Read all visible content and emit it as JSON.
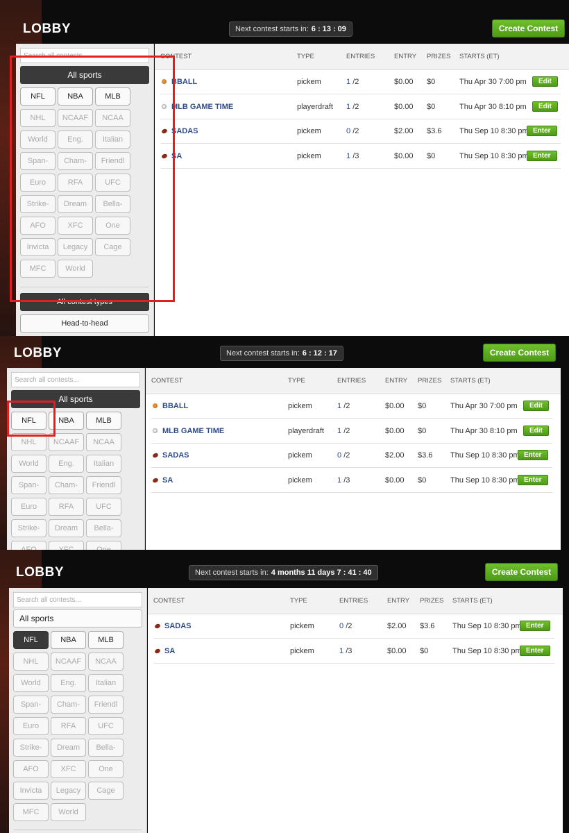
{
  "header": {
    "title": "LOBBY",
    "countdown_label": "Next contest starts in:",
    "create_label": "Create Contest"
  },
  "panels": [
    {
      "countdown_value": "6 : 13 : 09",
      "search_placeholder": "Search all contests...",
      "all_sports_label": "All sports"
    },
    {
      "countdown_value": "6 : 12 : 17",
      "search_placeholder": "Search all contests...",
      "all_sports_label": "All sports"
    },
    {
      "countdown_value": "4 months 11 days 7 : 41 : 40",
      "search_placeholder": "Search all contests...",
      "all_sports_label": "All sports"
    }
  ],
  "sports": [
    "NFL",
    "NBA",
    "MLB",
    "NHL",
    "NCAAF",
    "NCAA",
    "World",
    "Eng.",
    "Italian",
    "Span-",
    "Cham-",
    "Friendl",
    "Euro",
    "RFA",
    "UFC",
    "Strike-",
    "Dream",
    "Bella-",
    "AFO",
    "XFC",
    "One",
    "Invicta",
    "Legacy",
    "Cage",
    "MFC",
    "World"
  ],
  "contest_types": {
    "all": "All contest types",
    "h2h": "Head-to-head"
  },
  "table_headers": {
    "contest": "CONTEST",
    "type": "TYPE",
    "entries": "ENTRIES",
    "entry": "ENTRY",
    "prizes": "PRIZES",
    "starts": "STARTS (ET)"
  },
  "contests_all": [
    {
      "icon": "basketball-icon",
      "name": "BBALL",
      "type": "pickem",
      "entries": "1",
      "max": "/2",
      "entry": "$0.00",
      "prizes": "$0",
      "starts": "Thu Apr 30 7:00 pm",
      "action": "Edit"
    },
    {
      "icon": "baseball-icon",
      "name": "MLB GAME TIME",
      "type": "playerdraft",
      "entries": "1",
      "max": "/2",
      "entry": "$0.00",
      "prizes": "$0",
      "starts": "Thu Apr 30 8:10 pm",
      "action": "Edit"
    },
    {
      "icon": "football-icon",
      "name": "SADAS",
      "type": "pickem",
      "entries": "0",
      "max": "/2",
      "entry": "$2.00",
      "prizes": "$3.6",
      "starts": "Thu Sep 10 8:30 pm",
      "action": "Enter"
    },
    {
      "icon": "football-icon",
      "name": "SA",
      "type": "pickem",
      "entries": "1",
      "max": "/3",
      "entry": "$0.00",
      "prizes": "$0",
      "starts": "Thu Sep 10 8:30 pm",
      "action": "Enter"
    }
  ],
  "contests_nfl": [
    {
      "icon": "football-icon",
      "name": "SADAS",
      "type": "pickem",
      "entries": "0",
      "max": "/2",
      "entry": "$2.00",
      "prizes": "$3.6",
      "starts": "Thu Sep 10 8:30 pm",
      "action": "Enter"
    },
    {
      "icon": "football-icon",
      "name": "SA",
      "type": "pickem",
      "entries": "1",
      "max": "/3",
      "entry": "$0.00",
      "prizes": "$0",
      "starts": "Thu Sep 10 8:30 pm",
      "action": "Enter"
    }
  ],
  "colors": {
    "accent_green": "#5aad1f",
    "link_blue": "#2e4b8a",
    "highlight_red": "#e02020"
  }
}
